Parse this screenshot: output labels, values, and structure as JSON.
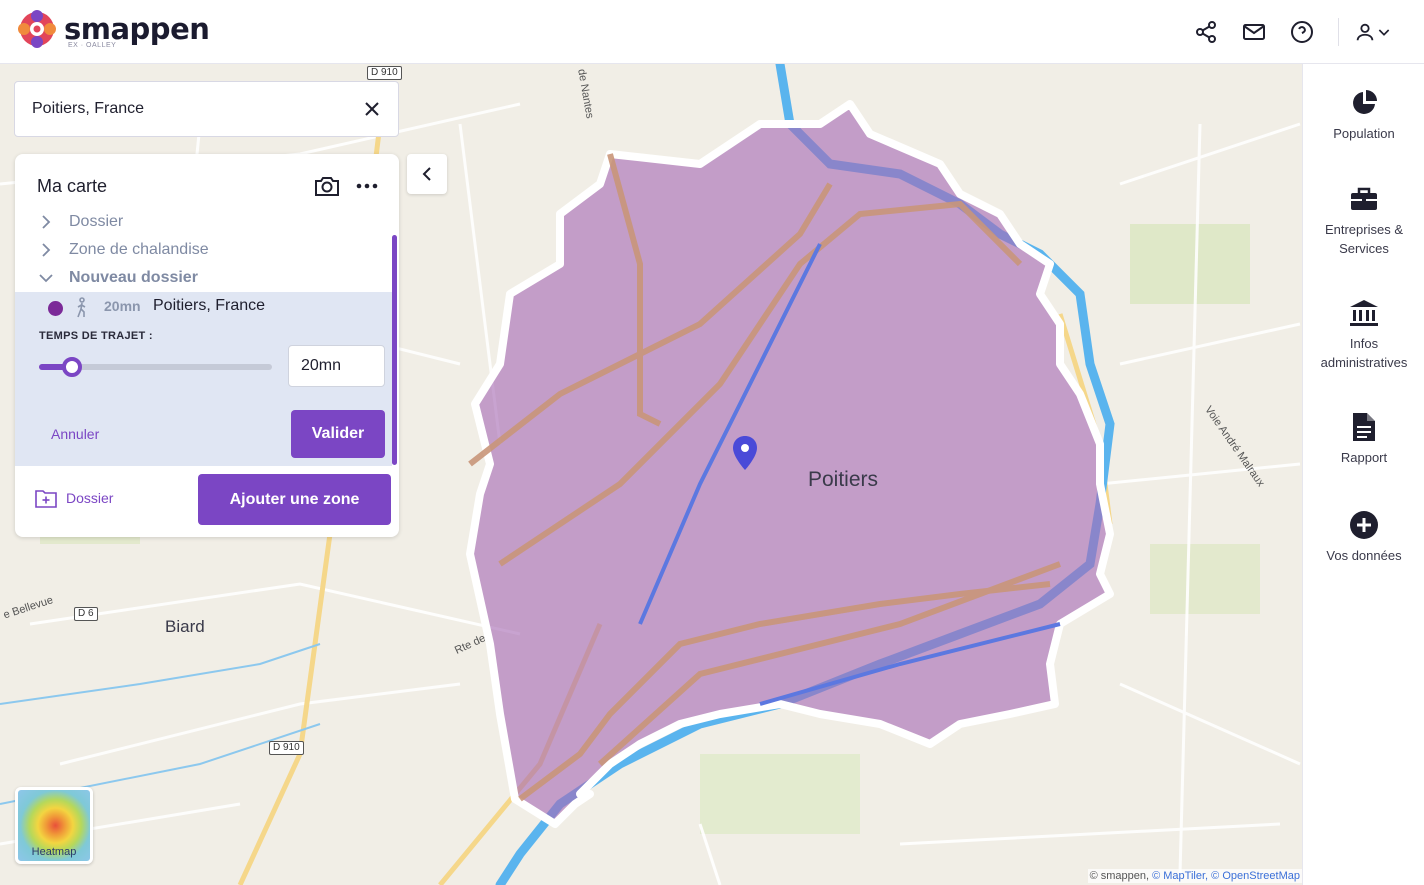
{
  "app": {
    "name": "smappen",
    "subtitle": "EX · OALLEY"
  },
  "header": {
    "icons": [
      "share-icon",
      "mail-icon",
      "help-icon",
      "user-icon",
      "chevron-down-icon"
    ]
  },
  "search": {
    "value": "Poitiers, France"
  },
  "panel": {
    "title": "Ma carte",
    "tree": [
      {
        "label": "Dossier",
        "expanded": false
      },
      {
        "label": "Zone de chalandise",
        "expanded": false
      },
      {
        "label": "Nouveau dossier",
        "expanded": true
      }
    ],
    "zone": {
      "time": "20mn",
      "name": "Poitiers, France",
      "color": "#7b2a98",
      "mode_icon": "walk-icon",
      "travel_label": "TEMPS DE TRAJET :",
      "minutes_value": "20mn",
      "slider_fraction": 0.14
    },
    "cancel_label": "Annuler",
    "validate_label": "Valider",
    "folder_label": "Dossier",
    "add_zone_label": "Ajouter une zone"
  },
  "map": {
    "city_label": "Poitiers",
    "town_label": "Biard",
    "road_labels": [
      "de Nantes",
      "Voie André Malraux",
      "Rte de",
      "e Bellevue"
    ],
    "road_badges": [
      "D 910",
      "D 6",
      "D 910"
    ],
    "heatmap_label": "Heatmap",
    "attribution": {
      "prefix": "© smappen,",
      "maptiler": "© MapTiler,",
      "osm": "© OpenStreetMap"
    },
    "accent_color": "#7b46c4",
    "zone_fill": "#a66ab4"
  },
  "sidebar": {
    "items": [
      {
        "label": "Population",
        "icon": "pie-chart-icon"
      },
      {
        "label": "Entreprises & Services",
        "icon": "briefcase-icon"
      },
      {
        "label": "Infos administratives",
        "icon": "bank-icon"
      },
      {
        "label": "Rapport",
        "icon": "document-icon"
      },
      {
        "label": "Vos données",
        "icon": "plus-circle-icon"
      }
    ]
  }
}
